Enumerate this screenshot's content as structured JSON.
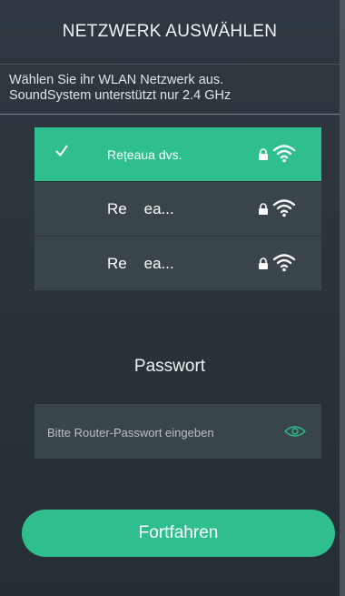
{
  "header": {
    "title": "NETZWERK AUSWÄHLEN"
  },
  "subtitle": {
    "line1": "Wählen Sie ihr WLAN Netzwerk aus.",
    "line2": "SoundSystem unterstützt nur 2.4 GHz"
  },
  "networks": [
    {
      "name": "Rețeaua dvs.",
      "selected": true,
      "secured": true,
      "icons": [
        "check-icon",
        "lock-icon",
        "wifi-icon"
      ]
    },
    {
      "name": "Re    ea...",
      "selected": false,
      "secured": true,
      "icons": [
        "lock-icon",
        "wifi-icon"
      ]
    },
    {
      "name": "Re    ea...",
      "selected": false,
      "secured": true,
      "icons": [
        "lock-icon",
        "wifi-icon"
      ]
    }
  ],
  "password": {
    "label": "Passwort",
    "placeholder": "Bitte Router-Passwort eingeben",
    "value": "",
    "toggle_icon": "eye-icon"
  },
  "continue_button": {
    "label": "Fortfahren"
  },
  "colors": {
    "background": "#2a3239",
    "accent": "#2fbf8e",
    "row": "#3a444b",
    "text": "#ffffff"
  }
}
